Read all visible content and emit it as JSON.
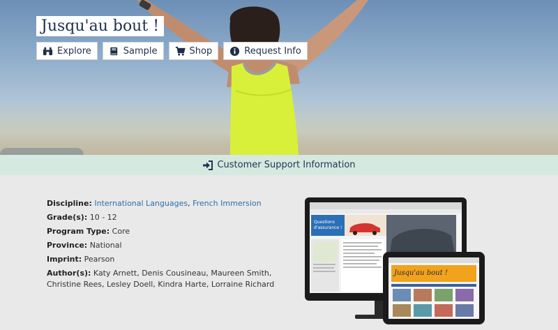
{
  "hero": {
    "title": "Jusqu'au bout !",
    "buttons": [
      {
        "label": "Explore",
        "icon": "binoculars-icon"
      },
      {
        "label": "Sample",
        "icon": "book-icon"
      },
      {
        "label": "Shop",
        "icon": "cart-icon"
      },
      {
        "label": "Request Info",
        "icon": "info-circle-icon"
      }
    ]
  },
  "support": {
    "label": "Customer Support Information",
    "icon": "sign-in-icon"
  },
  "details": {
    "discipline_label": "Discipline:",
    "discipline_links": [
      "International Languages",
      "French Immersion"
    ],
    "discipline_sep": ", ",
    "grades_label": "Grade(s):",
    "grades": "10 - 12",
    "program_label": "Program Type:",
    "program": "Core",
    "province_label": "Province:",
    "province": "National",
    "imprint_label": "Imprint:",
    "imprint": "Pearson",
    "authors_label": "Author(s):",
    "authors": "Katy Arnett, Denis Cousineau, Maureen Smith, Christine Rees, Lesley Doell, Kindra Harte, Lorraine Richard"
  },
  "devices": {
    "monitor_banner": "Questions d'assurance !",
    "tablet_banner": "Jusqu'au bout !"
  },
  "colors": {
    "support_bar": "#d5e9e0",
    "link": "#2a6fa8",
    "title_text": "#1e3050",
    "runner_top": "#d8f03a"
  }
}
